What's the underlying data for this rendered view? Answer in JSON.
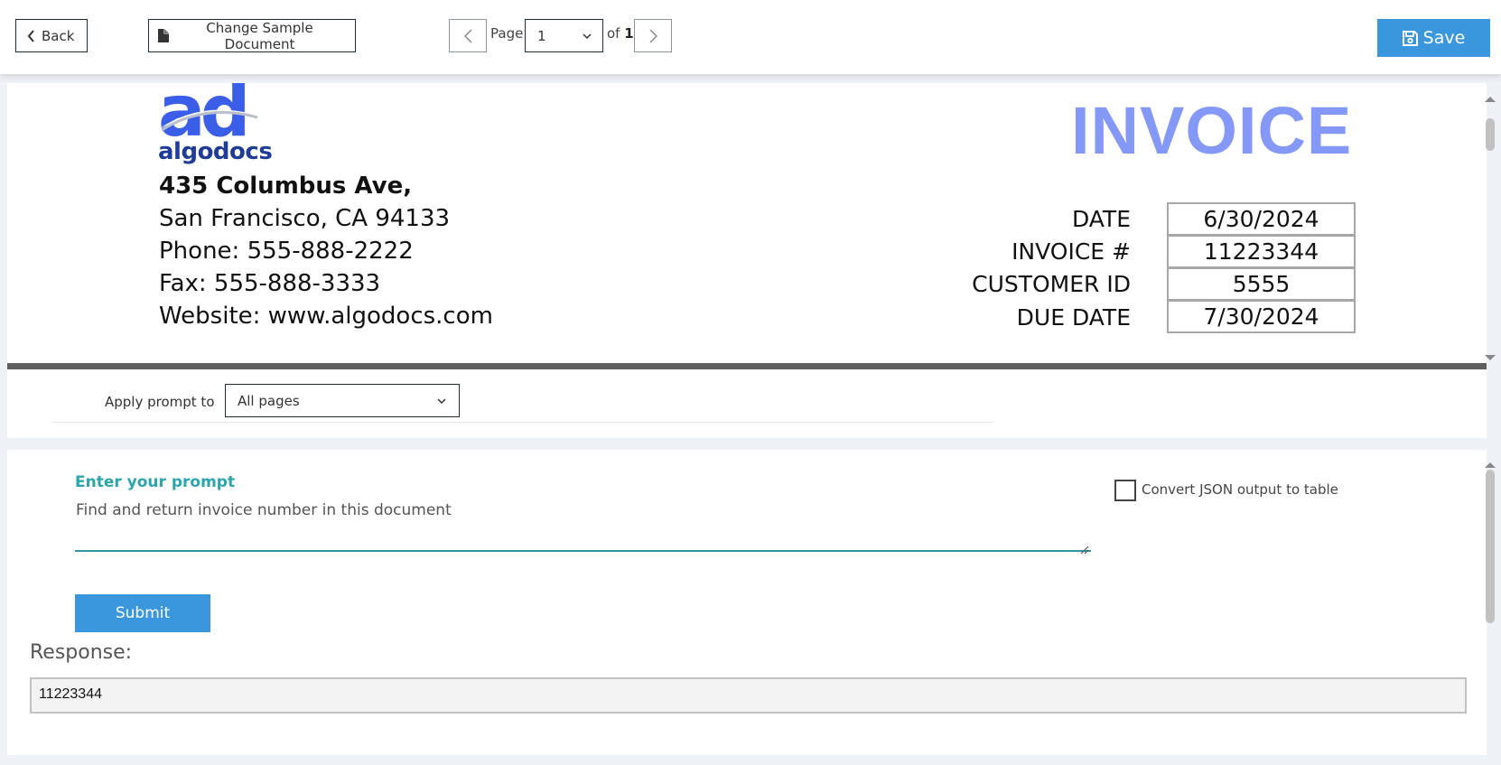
{
  "toolbar": {
    "back_label": "Back",
    "change_doc_label": "Change Sample Document",
    "page_label": "Page",
    "page_value": "1",
    "of_label": "of",
    "page_total": "1",
    "save_label": "Save"
  },
  "document": {
    "logo_text": "ad",
    "logo_word": "algodocs",
    "address_line1": "435 Columbus Ave,",
    "address_line2": "San Francisco, CA 94133",
    "phone": "Phone: 555-888-2222",
    "fax": "Fax: 555-888-3333",
    "website": "Website: www.algodocs.com",
    "title": "INVOICE",
    "fields": [
      {
        "label": "DATE",
        "value": "6/30/2024"
      },
      {
        "label": "INVOICE #",
        "value": "11223344"
      },
      {
        "label": "CUSTOMER ID",
        "value": "5555"
      },
      {
        "label": "DUE DATE",
        "value": "7/30/2024"
      }
    ]
  },
  "apply": {
    "label": "Apply prompt to",
    "selected": "All pages"
  },
  "prompt": {
    "label": "Enter your prompt",
    "value": "Find and return invoice number in this document",
    "checkbox_label": "Convert JSON output to table",
    "submit_label": "Submit",
    "response_label": "Response:",
    "response_value": "11223344"
  },
  "colors": {
    "accent": "#3a97dd",
    "teal": "#2aa4ad",
    "invoice_title": "#8398f7",
    "logo_blue": "#3b5ee8",
    "logo_dark": "#1f3c96"
  },
  "icons": {
    "back": "chevron-left-icon",
    "change_doc": "file-icon",
    "prev": "chevron-left-icon",
    "next": "chevron-right-icon",
    "save": "floppy-disk-icon",
    "dropdown": "chevron-down-icon"
  }
}
